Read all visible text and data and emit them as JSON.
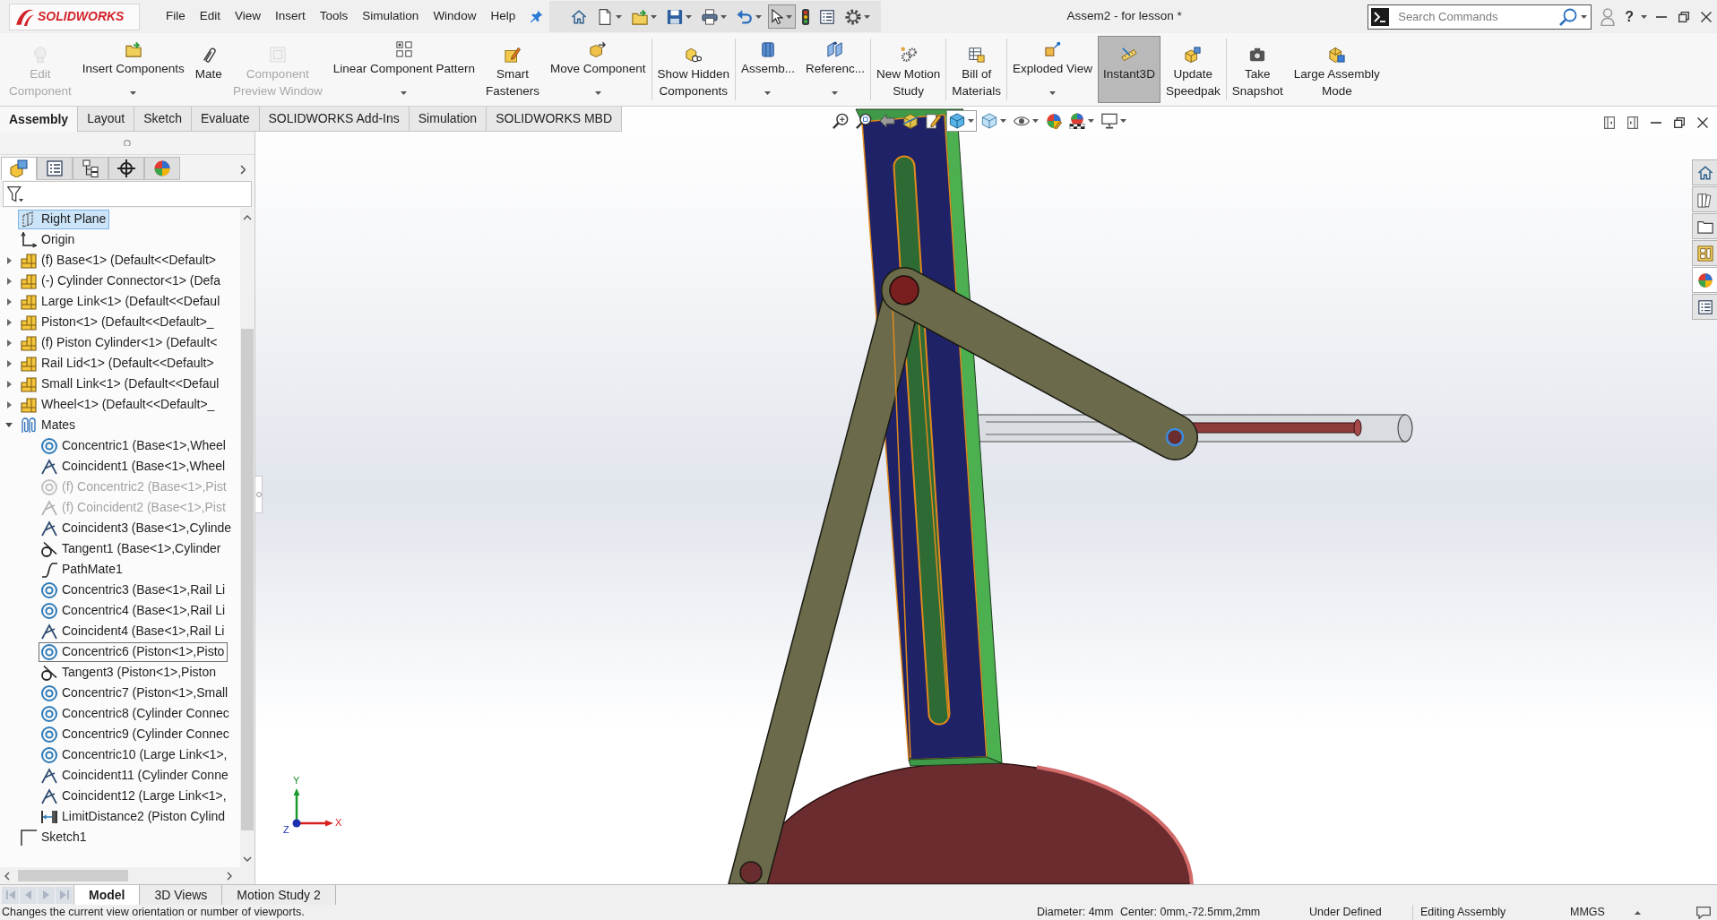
{
  "title_bar": {
    "logo": "SOLIDWORKS",
    "menu": [
      "File",
      "Edit",
      "View",
      "Insert",
      "Tools",
      "Simulation",
      "Window",
      "Help"
    ],
    "quick_access": [
      {
        "kind": "home",
        "dropdown": false,
        "pressed": false
      },
      {
        "kind": "new",
        "dropdown": true,
        "pressed": false
      },
      {
        "kind": "open",
        "dropdown": true,
        "pressed": false
      },
      {
        "kind": "save",
        "dropdown": true,
        "pressed": false
      },
      {
        "kind": "print",
        "dropdown": true,
        "pressed": false
      },
      {
        "kind": "undo",
        "dropdown": true,
        "pressed": false
      },
      {
        "kind": "select",
        "dropdown": true,
        "pressed": true
      },
      {
        "kind": "rebuild",
        "dropdown": false,
        "pressed": false
      },
      {
        "kind": "file-properties",
        "dropdown": false,
        "pressed": false
      },
      {
        "kind": "options",
        "dropdown": true,
        "pressed": false
      }
    ],
    "title": "Assem2 - for lesson *",
    "search": {
      "placeholder": "Search Commands"
    },
    "help": "?"
  },
  "ribbon": {
    "groups": [
      [
        {
          "kind": "edit-component",
          "label_lines": [
            "Edit",
            "Component"
          ],
          "dropdown": false,
          "disabled": true,
          "pressed": false
        },
        {
          "kind": "insert-components",
          "label_lines": [
            "Insert Components"
          ],
          "dropdown": true,
          "disabled": false,
          "pressed": false
        },
        {
          "kind": "mate",
          "label_lines": [
            "Mate"
          ],
          "dropdown": false,
          "disabled": false,
          "pressed": false
        },
        {
          "kind": "component-preview",
          "label_lines": [
            "Component",
            "Preview Window"
          ],
          "dropdown": false,
          "disabled": true,
          "pressed": false
        },
        {
          "kind": "linear-pattern",
          "label_lines": [
            "Linear Component Pattern"
          ],
          "dropdown": true,
          "disabled": false,
          "pressed": false
        },
        {
          "kind": "smart-fasteners",
          "label_lines": [
            "Smart",
            "Fasteners"
          ],
          "dropdown": false,
          "disabled": false,
          "pressed": false
        },
        {
          "kind": "move-component",
          "label_lines": [
            "Move Component"
          ],
          "dropdown": true,
          "disabled": false,
          "pressed": false
        }
      ],
      [
        {
          "kind": "show-hidden",
          "label_lines": [
            "Show Hidden",
            "Components"
          ],
          "dropdown": false,
          "disabled": false,
          "pressed": false
        }
      ],
      [
        {
          "kind": "assembly-features",
          "label_lines": [
            "Assemb..."
          ],
          "dropdown": true,
          "disabled": false,
          "pressed": false
        },
        {
          "kind": "reference-geometry",
          "label_lines": [
            "Referenc..."
          ],
          "dropdown": true,
          "disabled": false,
          "pressed": false
        }
      ],
      [
        {
          "kind": "motion-study",
          "label_lines": [
            "New Motion",
            "Study"
          ],
          "dropdown": false,
          "disabled": false,
          "pressed": false
        }
      ],
      [
        {
          "kind": "bom",
          "label_lines": [
            "Bill of",
            "Materials"
          ],
          "dropdown": false,
          "disabled": false,
          "pressed": false
        }
      ],
      [
        {
          "kind": "exploded-view",
          "label_lines": [
            "Exploded View"
          ],
          "dropdown": true,
          "disabled": false,
          "pressed": false
        },
        {
          "kind": "instant3d",
          "label_lines": [
            "Instant3D"
          ],
          "dropdown": false,
          "disabled": false,
          "pressed": true
        },
        {
          "kind": "speedpak",
          "label_lines": [
            "Update",
            "Speedpak"
          ],
          "dropdown": false,
          "disabled": false,
          "pressed": false
        }
      ],
      [
        {
          "kind": "snapshot",
          "label_lines": [
            "Take",
            "Snapshot"
          ],
          "dropdown": false,
          "disabled": false,
          "pressed": false
        },
        {
          "kind": "large-assembly",
          "label_lines": [
            "Large Assembly",
            "Mode"
          ],
          "dropdown": false,
          "disabled": false,
          "pressed": false
        }
      ]
    ]
  },
  "command_tabs": [
    {
      "label": "Assembly",
      "selected": true
    },
    {
      "label": "Layout",
      "selected": false
    },
    {
      "label": "Sketch",
      "selected": false
    },
    {
      "label": "Evaluate",
      "selected": false
    },
    {
      "label": "SOLIDWORKS Add-Ins",
      "selected": false
    },
    {
      "label": "Simulation",
      "selected": false
    },
    {
      "label": "SOLIDWORKS MBD",
      "selected": false
    }
  ],
  "feature_manager": {
    "tabs": [
      {
        "kind": "feature-tree",
        "selected": true
      },
      {
        "kind": "property-manager",
        "selected": false
      },
      {
        "kind": "configuration-manager",
        "selected": false
      },
      {
        "kind": "dimxpert",
        "selected": false
      },
      {
        "kind": "display-manager",
        "selected": false
      }
    ],
    "tree": [
      {
        "label": "Right Plane",
        "kind": "plane",
        "selected": true
      },
      {
        "label": "Origin",
        "kind": "origin",
        "selected": false
      },
      {
        "label": "(f) Base<1> (Default<<Default>",
        "kind": "part",
        "expanded": false,
        "selected": false
      },
      {
        "label": "(-) Cylinder Connector<1> (Defa",
        "kind": "part",
        "expanded": false,
        "selected": false
      },
      {
        "label": "Large Link<1> (Default<<Defaul",
        "kind": "part",
        "expanded": false,
        "selected": false
      },
      {
        "label": "Piston<1> (Default<<Default>_",
        "kind": "part",
        "expanded": false,
        "selected": false
      },
      {
        "label": "(f) Piston Cylinder<1> (Default<",
        "kind": "part",
        "expanded": false,
        "selected": false
      },
      {
        "label": "Rail Lid<1> (Default<<Default>",
        "kind": "part",
        "expanded": false,
        "selected": false
      },
      {
        "label": "Small Link<1> (Default<<Defaul",
        "kind": "part",
        "expanded": false,
        "selected": false
      },
      {
        "label": "Wheel<1> (Default<<Default>_",
        "kind": "part",
        "expanded": false,
        "selected": false
      },
      {
        "label": "Mates",
        "kind": "mates",
        "expanded": true,
        "selected": false,
        "children": [
          {
            "label": "Concentric1 (Base<1>,Wheel",
            "kind": "concentric",
            "selected": false,
            "focused": false,
            "suppressed": false
          },
          {
            "label": "Coincident1 (Base<1>,Wheel",
            "kind": "coincident",
            "selected": false,
            "focused": false,
            "suppressed": false
          },
          {
            "label": "(f) Concentric2 (Base<1>,Pist",
            "kind": "concentric",
            "selected": false,
            "focused": false,
            "suppressed": true
          },
          {
            "label": "(f) Coincident2 (Base<1>,Pist",
            "kind": "coincident",
            "selected": false,
            "focused": false,
            "suppressed": true
          },
          {
            "label": "Coincident3 (Base<1>,Cylinde",
            "kind": "coincident",
            "selected": false,
            "focused": false,
            "suppressed": false
          },
          {
            "label": "Tangent1 (Base<1>,Cylinder",
            "kind": "tangent",
            "selected": false,
            "focused": false,
            "suppressed": false
          },
          {
            "label": "PathMate1",
            "kind": "path",
            "selected": false,
            "focused": false,
            "suppressed": false
          },
          {
            "label": "Concentric3 (Base<1>,Rail Li",
            "kind": "concentric",
            "selected": false,
            "focused": false,
            "suppressed": false
          },
          {
            "label": "Concentric4 (Base<1>,Rail Li",
            "kind": "concentric",
            "selected": false,
            "focused": false,
            "suppressed": false
          },
          {
            "label": "Coincident4 (Base<1>,Rail Li",
            "kind": "coincident",
            "selected": false,
            "focused": false,
            "suppressed": false
          },
          {
            "label": "Concentric6 (Piston<1>,Pisto",
            "kind": "concentric",
            "selected": false,
            "focused": true,
            "suppressed": false
          },
          {
            "label": "Tangent3 (Piston<1>,Piston",
            "kind": "tangent",
            "selected": false,
            "focused": false,
            "suppressed": false
          },
          {
            "label": "Concentric7 (Piston<1>,Small",
            "kind": "concentric",
            "selected": false,
            "focused": false,
            "suppressed": false
          },
          {
            "label": "Concentric8 (Cylinder Connec",
            "kind": "concentric",
            "selected": false,
            "focused": false,
            "suppressed": false
          },
          {
            "label": "Concentric9 (Cylinder Connec",
            "kind": "concentric",
            "selected": false,
            "focused": false,
            "suppressed": false
          },
          {
            "label": "Concentric10 (Large Link<1>,",
            "kind": "concentric",
            "selected": false,
            "focused": false,
            "suppressed": false
          },
          {
            "label": "Coincident11 (Cylinder Conne",
            "kind": "coincident",
            "selected": false,
            "focused": false,
            "suppressed": false
          },
          {
            "label": "Coincident12 (Large Link<1>,",
            "kind": "coincident",
            "selected": false,
            "focused": false,
            "suppressed": false
          },
          {
            "label": "LimitDistance2 (Piston Cylind",
            "kind": "limit-distance",
            "selected": false,
            "focused": false,
            "suppressed": false
          }
        ]
      },
      {
        "label": "Sketch1",
        "kind": "sketch",
        "selected": false
      }
    ]
  },
  "view_toolbar": [
    {
      "kind": "zoom-to-fit",
      "dropdown": false,
      "pressed": false
    },
    {
      "kind": "zoom-to-area",
      "dropdown": false,
      "pressed": false
    },
    {
      "kind": "previous-view",
      "dropdown": false,
      "pressed": false
    },
    {
      "kind": "section-view",
      "dropdown": false,
      "pressed": false
    },
    {
      "kind": "dynamic-annotation",
      "dropdown": false,
      "pressed": false
    },
    {
      "kind": "view-orientation",
      "dropdown": true,
      "pressed": true
    },
    {
      "kind": "display-style",
      "dropdown": true,
      "pressed": false
    },
    {
      "kind": "hide-show",
      "dropdown": true,
      "pressed": false
    },
    {
      "kind": "edit-appearance",
      "dropdown": false,
      "pressed": false
    },
    {
      "kind": "apply-scene",
      "dropdown": true,
      "pressed": false
    },
    {
      "kind": "view-settings",
      "dropdown": true,
      "pressed": false
    }
  ],
  "triad": [
    "Y",
    "X",
    "Z"
  ],
  "task_pane": [
    {
      "kind": "resources",
      "selected": false
    },
    {
      "kind": "design-library",
      "selected": false
    },
    {
      "kind": "file-explorer",
      "selected": false
    },
    {
      "kind": "view-palette",
      "selected": false
    },
    {
      "kind": "appearances",
      "selected": true
    },
    {
      "kind": "custom-properties",
      "selected": false
    }
  ],
  "bottom_bar": {
    "scroll_buttons": [
      {
        "kind": "first",
        "disabled": true
      },
      {
        "kind": "previous",
        "disabled": true
      },
      {
        "kind": "next",
        "disabled": true
      },
      {
        "kind": "last",
        "disabled": true
      }
    ],
    "tabs": [
      {
        "label": "Model",
        "selected": true
      },
      {
        "label": "3D Views",
        "selected": false
      },
      {
        "label": "Motion Study 2",
        "selected": false
      }
    ]
  },
  "status_bar": {
    "message": "Changes the current view orientation or number of viewports.",
    "fields": [
      "Diameter: 4mm",
      "Center: 0mm,-72.5mm,2mm",
      "Under Defined",
      "Editing Assembly",
      "MMGS"
    ]
  }
}
